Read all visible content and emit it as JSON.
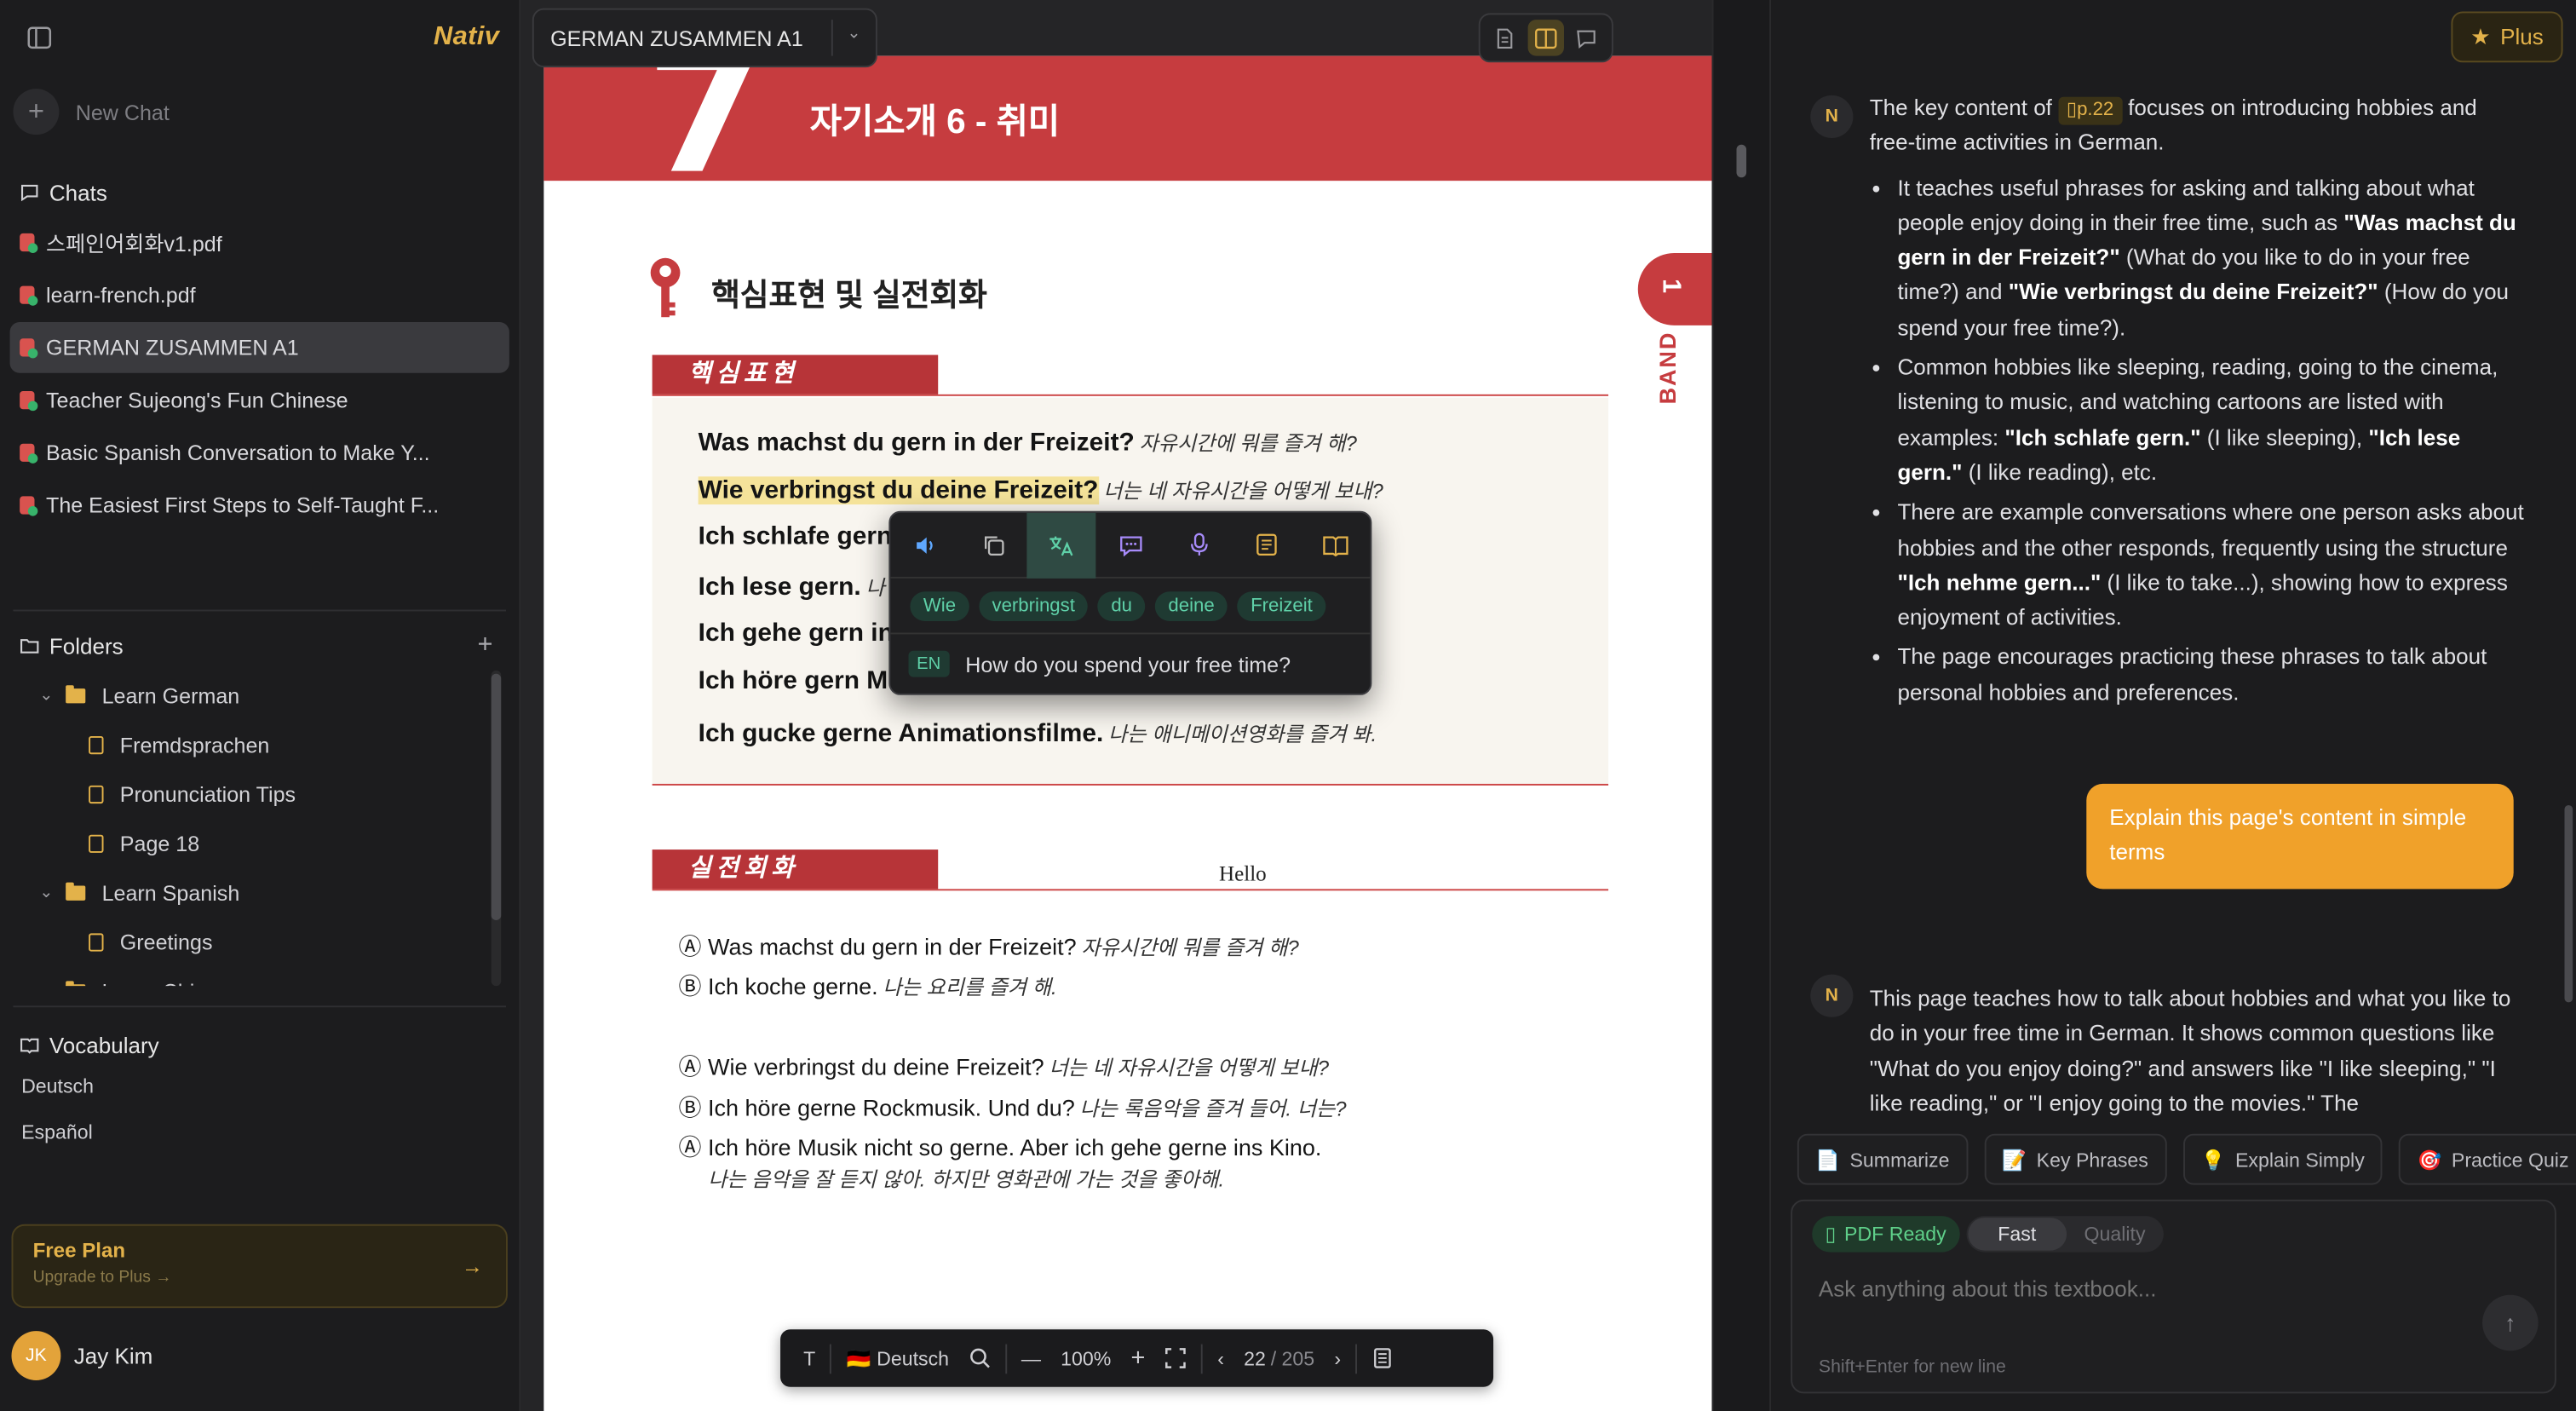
{
  "sidebar": {
    "brand": "Nativ",
    "new_chat": "New Chat",
    "chats_heading": "Chats",
    "chats": [
      {
        "label": "스페인어회화v1.pdf",
        "active": false
      },
      {
        "label": "learn-french.pdf",
        "active": false
      },
      {
        "label": "GERMAN ZUSAMMEN A1",
        "active": true
      },
      {
        "label": "Teacher Sujeong's Fun Chinese",
        "active": false
      },
      {
        "label": "Basic Spanish Conversation to Make Y...",
        "active": false
      },
      {
        "label": "The Easiest First Steps to Self-Taught F...",
        "active": false
      }
    ],
    "folders_heading": "Folders",
    "folders": [
      {
        "label": "Learn German",
        "type": "folder",
        "expanded": true
      },
      {
        "label": "Fremdsprachen",
        "type": "doc"
      },
      {
        "label": "Pronunciation Tips",
        "type": "doc"
      },
      {
        "label": "Page 18",
        "type": "doc"
      },
      {
        "label": "Learn Spanish",
        "type": "folder",
        "expanded": true
      },
      {
        "label": "Greetings",
        "type": "doc"
      },
      {
        "label": "Learn Chinese",
        "type": "folder",
        "expanded": true
      }
    ],
    "vocabulary_heading": "Vocabulary",
    "vocabulary": [
      "Deutsch",
      "Español"
    ],
    "plan": {
      "title": "Free Plan",
      "subtitle": "Upgrade to Plus →"
    },
    "user": {
      "initials": "JK",
      "name": "Jay Kim"
    }
  },
  "document": {
    "title": "GERMAN ZUSAMMEN A1",
    "chapter_number": "7",
    "chapter_title": "자기소개 6 - 취미",
    "section_title": "핵심표현 및 실전회화",
    "tag_phrases": "핵심표현",
    "tag_conversation": "실전회화",
    "band_number": "1",
    "band_label": "BAND",
    "phrases": [
      {
        "de": "Was machst du gern in der Freizeit?",
        "ko": "자유시간에 뭐를 즐겨 해?",
        "highlight": false
      },
      {
        "de": "Wie verbringst du deine Freizeit?",
        "ko": "너는 네 자유시간을 어떻게 보내?",
        "highlight": true
      },
      {
        "de": "Ich schlafe gern.",
        "ko": "",
        "highlight": false
      },
      {
        "de": "Ich lese gern.",
        "ko": "나",
        "highlight": false
      },
      {
        "de": "Ich gehe gern ins Kino.",
        "ko": "",
        "highlight": false
      },
      {
        "de": "Ich höre gern Musik.",
        "ko": "",
        "highlight": false
      },
      {
        "de": "Ich gucke gerne Animationsfilme.",
        "ko": "나는 애니메이션영화를 즐겨 봐.",
        "highlight": false
      }
    ],
    "hello": "Hello",
    "conversation": [
      {
        "speaker": "Ⓐ",
        "de": "Was machst du gern in der Freizeit?",
        "ko": "자유시간에 뭐를 즐겨 해?"
      },
      {
        "speaker": "Ⓑ",
        "de": "Ich koche gerne.",
        "ko": "나는 요리를 즐겨 해."
      },
      {
        "speaker": "Ⓐ",
        "de": "Wie verbringst du deine Freizeit?",
        "ko": "너는 네 자유시간을 어떻게 보내?"
      },
      {
        "speaker": "Ⓑ",
        "de": "Ich höre gerne Rockmusik. Und du?",
        "ko": "나는 록음악을 즐겨 들어. 너는?"
      },
      {
        "speaker": "Ⓐ",
        "de": "Ich höre Musik nicht so gerne. Aber ich gehe gerne ins Kino.",
        "ko": ""
      }
    ],
    "conversation_last_ko": "나는 음악을 잘 듣지 않아. 하지만 영화관에 가는 것을 좋아해."
  },
  "popover": {
    "words": [
      "Wie",
      "verbringst",
      "du",
      "deine",
      "Freizeit"
    ],
    "lang_badge": "EN",
    "translation": "How do you spend your free time?"
  },
  "pdf_toolbar": {
    "text_tool": "T",
    "language": "🇩🇪 Deutsch",
    "zoom": "100%",
    "page_current": "22",
    "page_total": "/ 205"
  },
  "chat": {
    "plus_label": "Plus",
    "bot_avatar": "N",
    "msg1": {
      "intro_before": "The key content of",
      "page_ref": "p.22",
      "intro_after": "focuses on introducing hobbies and free-time activities in German.",
      "bullets": [
        {
          "t1": "It teaches useful phrases for asking and talking about what people enjoy doing in their free time, such as ",
          "b1": "\"Was machst du gern in der Freizeit?\"",
          "t2": " (What do you like to do in your free time?) and ",
          "b2": "\"Wie verbringst du deine Freizeit?\"",
          "t3": " (How do you spend your free time?)."
        },
        {
          "t1": "Common hobbies like sleeping, reading, going to the cinema, listening to music, and watching cartoons are listed with examples: ",
          "b1": "\"Ich schlafe gern.\"",
          "t2": " (I like sleeping), ",
          "b2": "\"Ich lese gern.\"",
          "t3": " (I like reading), etc."
        },
        {
          "t1": "There are example conversations where one person asks about hobbies and the other responds, frequently using the structure ",
          "b1": "\"Ich nehme gern...\"",
          "t2": " (I like to take...), showing how to express enjoyment of activities.",
          "b2": "",
          "t3": ""
        },
        {
          "t1": "The page encourages practicing these phrases to talk about personal hobbies and preferences.",
          "b1": "",
          "t2": "",
          "b2": "",
          "t3": ""
        }
      ]
    },
    "user_msg": "Explain this page's content in simple terms",
    "msg2": "This page teaches how to talk about hobbies and what you like to do in your free time in German. It shows common questions like \"What do you enjoy doing?\" and answers like \"I like sleeping,\" \"I like reading,\" or \"I enjoy going to the movies.\" The",
    "suggestions": [
      {
        "icon": "📄",
        "label": "Summarize"
      },
      {
        "icon": "📝",
        "label": "Key Phrases"
      },
      {
        "icon": "💡",
        "label": "Explain Simply"
      },
      {
        "icon": "🎯",
        "label": "Practice Quiz"
      }
    ],
    "pdf_ready": "PDF Ready",
    "mode_fast": "Fast",
    "mode_quality": "Quality",
    "placeholder": "Ask anything about this textbook...",
    "hint": "Shift+Enter for new line"
  },
  "colors": {
    "accent": "#e3b24a",
    "brand_red": "#c63c3f",
    "user_bubble": "#f0a12a",
    "chip_green": "#5fd0a8"
  }
}
